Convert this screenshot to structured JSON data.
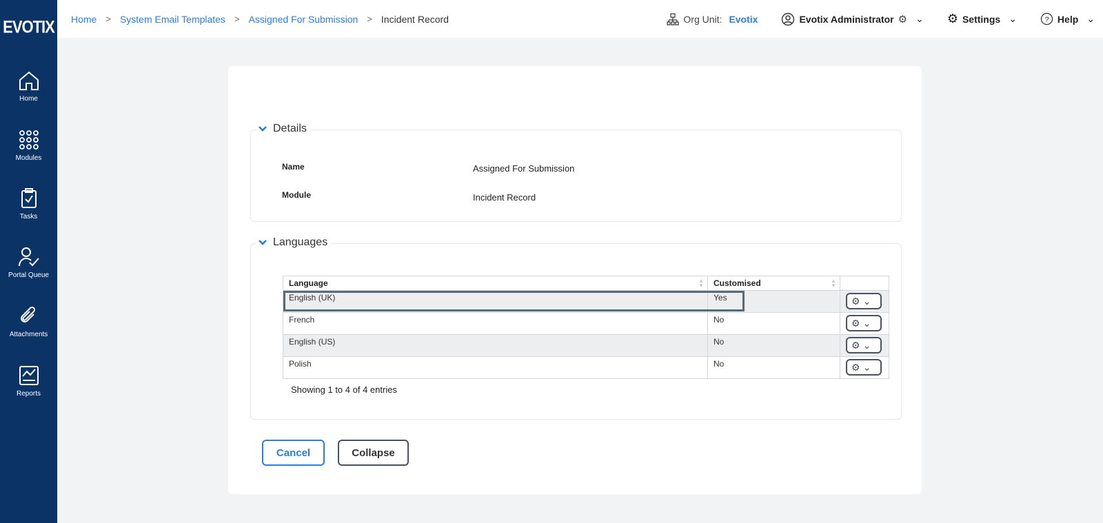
{
  "app": {
    "logo": "EVOTIX"
  },
  "sidebar": {
    "items": [
      {
        "label": "Home"
      },
      {
        "label": "Modules"
      },
      {
        "label": "Tasks"
      },
      {
        "label": "Portal Queue"
      },
      {
        "label": "Attachments"
      },
      {
        "label": "Reports"
      }
    ]
  },
  "breadcrumb": {
    "items": [
      "Home",
      "System Email Templates",
      "Assigned For Submission"
    ],
    "current": "Incident Record"
  },
  "header": {
    "org_label": "Org Unit:",
    "org_value": "Evotix",
    "user": "Evotix Administrator",
    "settings": "Settings",
    "help": "Help"
  },
  "details": {
    "title": "Details",
    "fields": [
      {
        "label": "Name",
        "value": "Assigned For Submission"
      },
      {
        "label": "Module",
        "value": "Incident Record"
      }
    ]
  },
  "languages": {
    "title": "Languages",
    "columns": [
      "Language",
      "Customised"
    ],
    "rows": [
      {
        "language": "English (UK)",
        "customised": "Yes"
      },
      {
        "language": "French",
        "customised": "No"
      },
      {
        "language": "English (US)",
        "customised": "No"
      },
      {
        "language": "Polish",
        "customised": "No"
      }
    ],
    "info": "Showing 1 to 4 of 4 entries"
  },
  "buttons": {
    "cancel": "Cancel",
    "collapse": "Collapse"
  },
  "colors": {
    "sidebar": "#0b3366",
    "accent": "#2a7de1"
  }
}
